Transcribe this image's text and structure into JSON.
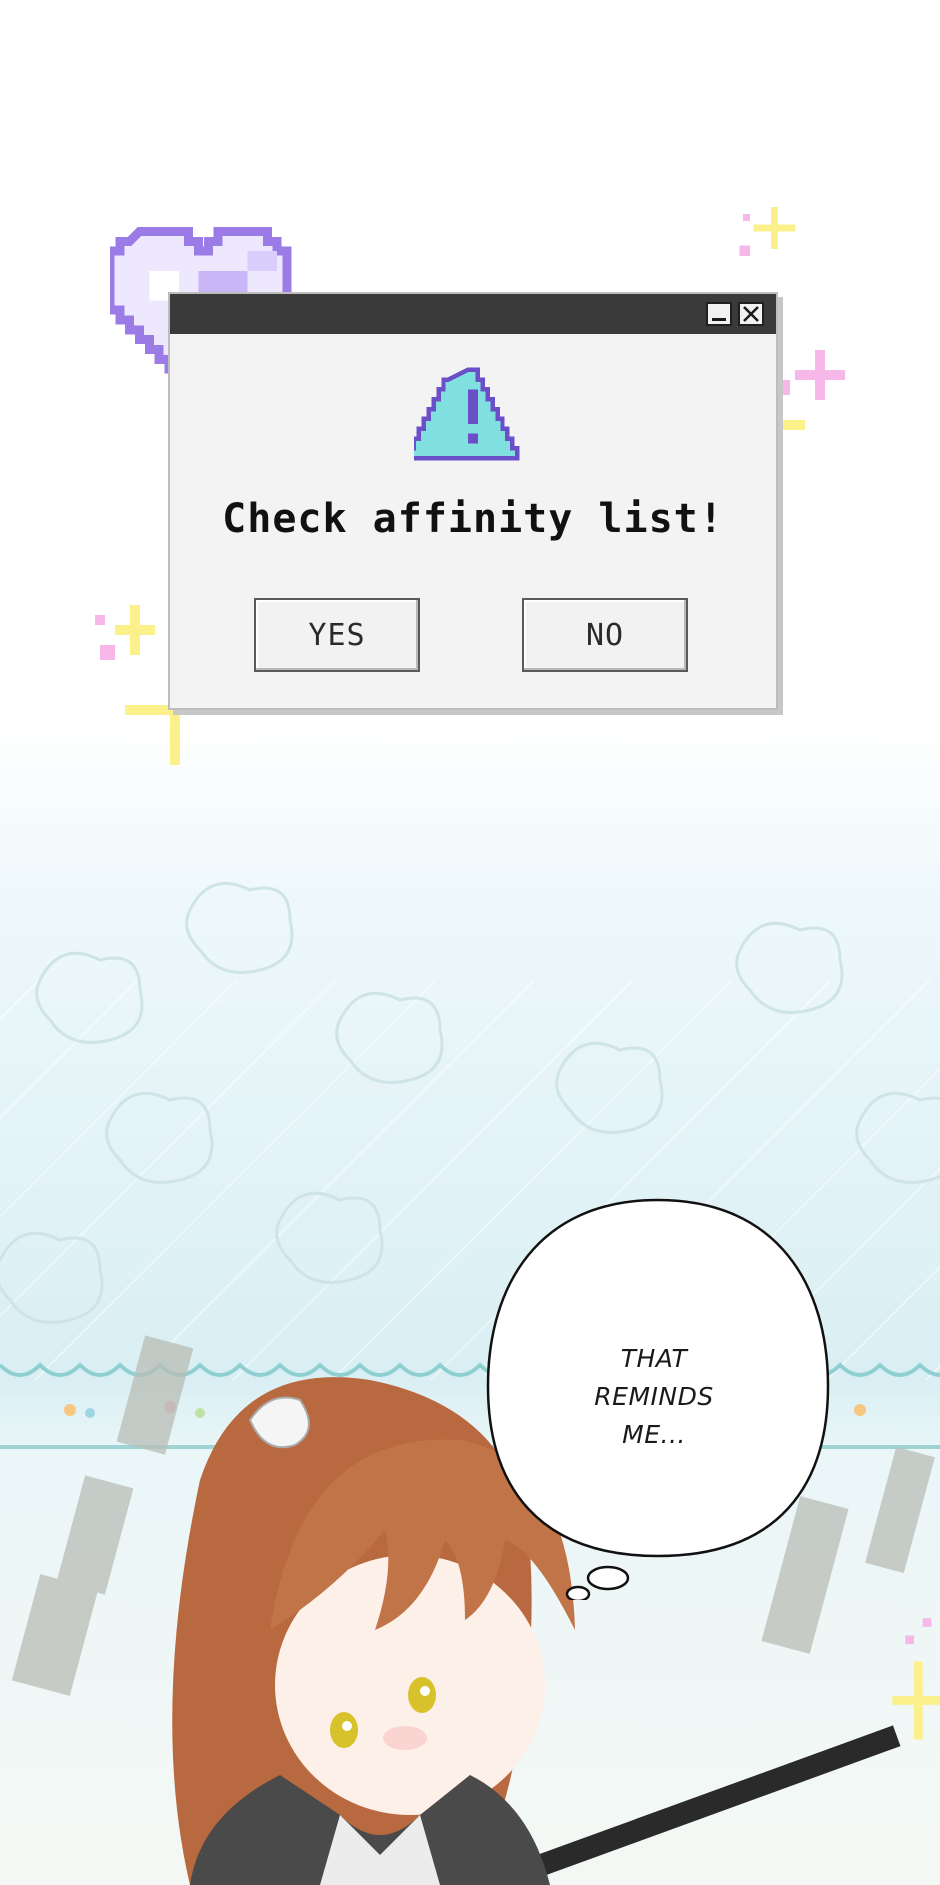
{
  "dialog": {
    "message": "Check affinity list!",
    "yes_label": "YES",
    "no_label": "NO",
    "warning_icon": "warning-triangle-icon",
    "minimize_icon": "minimize-icon",
    "close_icon": "close-icon"
  },
  "decorations": {
    "heart_icon": "pixel-heart-icon",
    "sparkle_icon": "sparkle-icon"
  },
  "speech_bubble": {
    "line1": "THAT",
    "line2": "REMINDS",
    "line3": "ME..."
  },
  "colors": {
    "titlebar": "#3a3a3a",
    "warning_fill": "#7fe0df",
    "warning_border": "#6a4fc9",
    "heart": "#b49af0",
    "sparkle_yellow": "#fbf08a",
    "sparkle_pink": "#f6b8e8",
    "floor_line": "#9fd3d4"
  }
}
